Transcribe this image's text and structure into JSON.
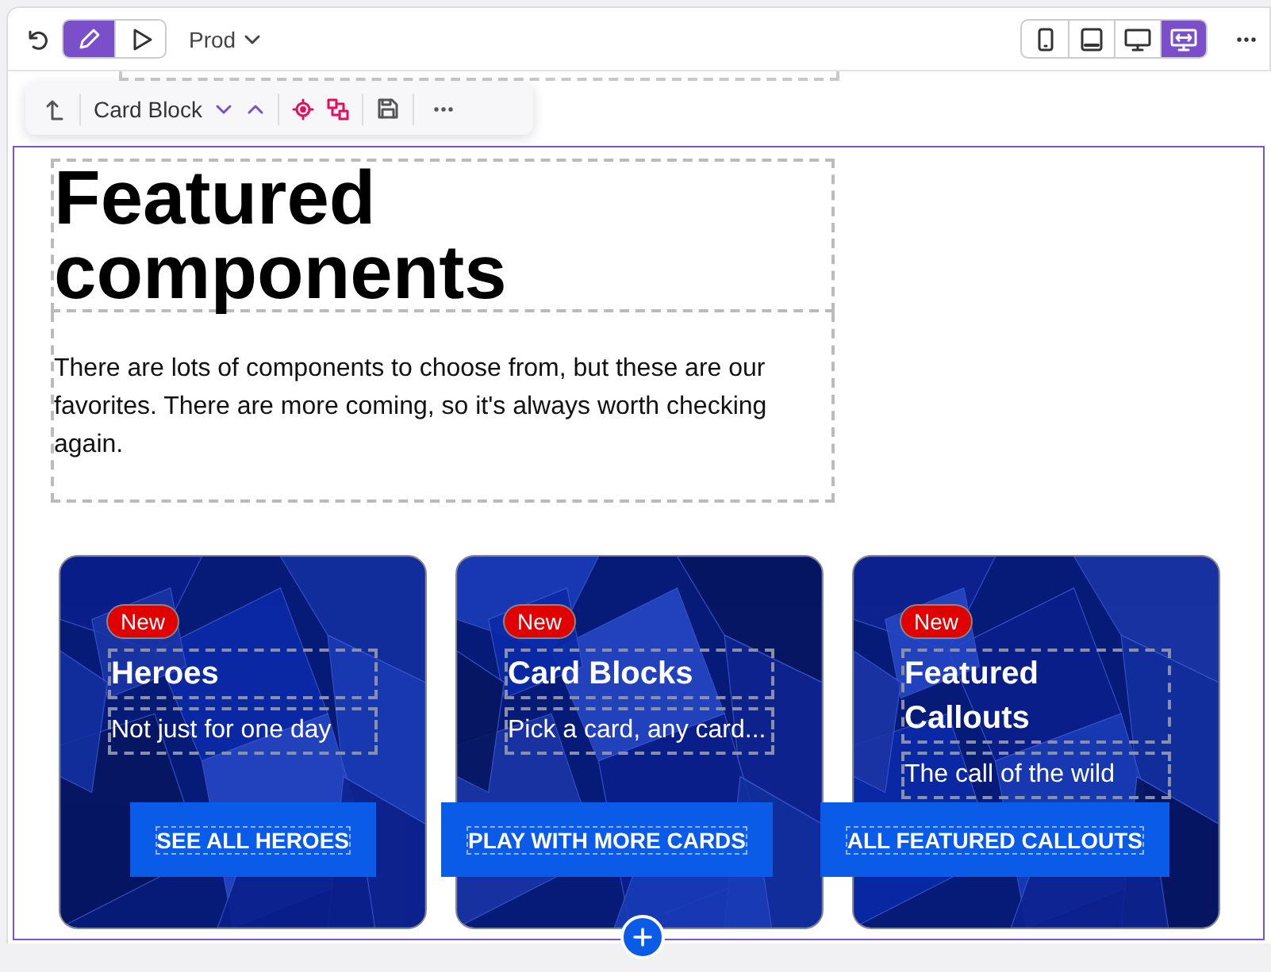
{
  "topbar": {
    "modes": [
      {
        "kind": "edit",
        "selected": true
      },
      {
        "kind": "preview",
        "selected": false
      }
    ],
    "environment": "Prod",
    "devices": [
      {
        "kind": "phone",
        "selected": false
      },
      {
        "kind": "tablet",
        "selected": false
      },
      {
        "kind": "desktop",
        "selected": false
      },
      {
        "kind": "wide",
        "selected": true
      }
    ]
  },
  "block_toolbar": {
    "label": "Card Block"
  },
  "section": {
    "heading": "Featured components",
    "paragraph": "There are lots of components to choose from, but these are our favorites. There are more coming, so it's always worth checking again."
  },
  "cards": [
    {
      "badge": "New",
      "title": "Heroes",
      "description": "Not just for one day",
      "button": "SEE ALL HEROES"
    },
    {
      "badge": "New",
      "title": "Card Blocks",
      "description": "Pick a card, any card...",
      "button": "PLAY WITH MORE CARDS"
    },
    {
      "badge": "New",
      "title": "Featured Callouts",
      "description": "The call of the wild",
      "button": "ALL FEATURED CALLOUTS"
    }
  ]
}
